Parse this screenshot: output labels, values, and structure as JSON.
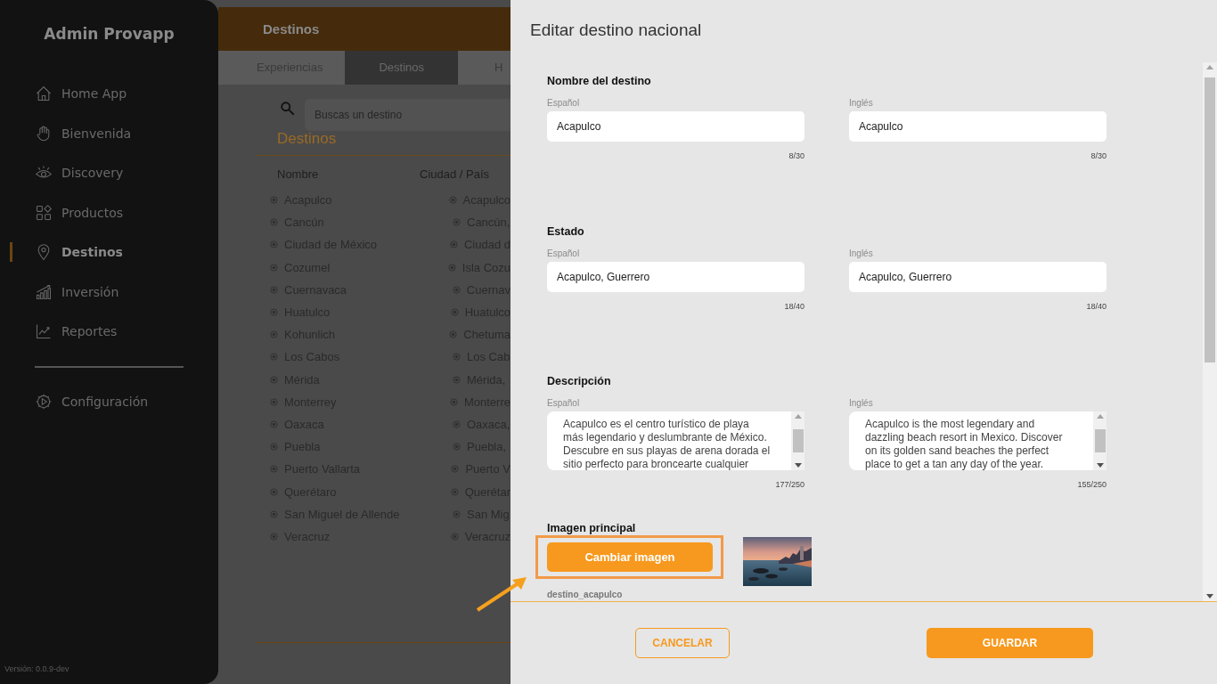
{
  "sidebar": {
    "title": "Admin Provapp",
    "items": [
      {
        "label": "Home App",
        "selected": false
      },
      {
        "label": "Bienvenida",
        "selected": false
      },
      {
        "label": "Discovery",
        "selected": false
      },
      {
        "label": "Productos",
        "selected": false
      },
      {
        "label": "Destinos",
        "selected": true
      },
      {
        "label": "Inversión",
        "selected": false
      },
      {
        "label": "Reportes",
        "selected": false
      }
    ],
    "settings_item": {
      "label": "Configuración",
      "selected": false
    },
    "version": "Versión: 0.0.9-dev"
  },
  "page": {
    "header_title": "Destinos",
    "tabs": [
      {
        "label": "Experiencias",
        "selected": false
      },
      {
        "label": "Destinos",
        "selected": true
      },
      {
        "label": "H",
        "selected": false
      }
    ],
    "search": {
      "placeholder": "Buscas un destino"
    },
    "section_title": "Destinos",
    "table": {
      "columns": [
        "Nombre",
        "Ciudad / País"
      ],
      "rows": [
        [
          "Acapulco",
          "Acapulco"
        ],
        [
          "Cancún",
          "Cancún,"
        ],
        [
          "Ciudad de México",
          "Ciudad d"
        ],
        [
          "Cozumel",
          "Isla Cozu"
        ],
        [
          "Cuernavaca",
          "Cuernav"
        ],
        [
          "Huatulco",
          "Huatulco"
        ],
        [
          "Kohunlich",
          "Chetuma"
        ],
        [
          "Los Cabos",
          "Los Cab"
        ],
        [
          "Mérida",
          "Mérida,"
        ],
        [
          "Monterrey",
          "Monterre"
        ],
        [
          "Oaxaca",
          "Oaxaca,"
        ],
        [
          "Puebla",
          "Puebla,"
        ],
        [
          "Puerto Vallarta",
          "Puerto V"
        ],
        [
          "Querétaro",
          "Querétar"
        ],
        [
          "San Miguel de Allende",
          "San Mig"
        ],
        [
          "Veracruz",
          "Veracruz"
        ]
      ]
    }
  },
  "modal": {
    "title": "Editar destino nacional",
    "sections": [
      {
        "heading": "Nombre del destino",
        "kind": "input",
        "fields": [
          {
            "label": "Español",
            "value": "Acapulco",
            "counter": "8/30"
          },
          {
            "label": "Inglés",
            "value": "Acapulco",
            "counter": "8/30"
          }
        ]
      },
      {
        "heading": "Estado",
        "kind": "input",
        "fields": [
          {
            "label": "Español",
            "value": "Acapulco, Guerrero",
            "counter": "18/40"
          },
          {
            "label": "Inglés",
            "value": "Acapulco, Guerrero",
            "counter": "18/40"
          }
        ]
      },
      {
        "heading": "Descripción",
        "kind": "textarea",
        "fields": [
          {
            "label": "Español",
            "value": "Acapulco es el centro turístico de playa más legendario y deslumbrante de México. Descubre en sus playas de arena dorada el sitio perfecto para broncearte cualquier",
            "counter": "177/250"
          },
          {
            "label": "Inglés",
            "value": "Acapulco is the most legendary and dazzling beach resort in Mexico. Discover on its golden sand beaches the perfect place to get a tan any day of the year.",
            "counter": "155/250"
          }
        ]
      }
    ],
    "image": {
      "heading": "Imagen principal",
      "button": "Cambiar imagen",
      "highlighted": true,
      "filename": "destino_acapulco"
    },
    "buttons": {
      "cancel": "CANCELAR",
      "save": "GUARDAR"
    }
  }
}
